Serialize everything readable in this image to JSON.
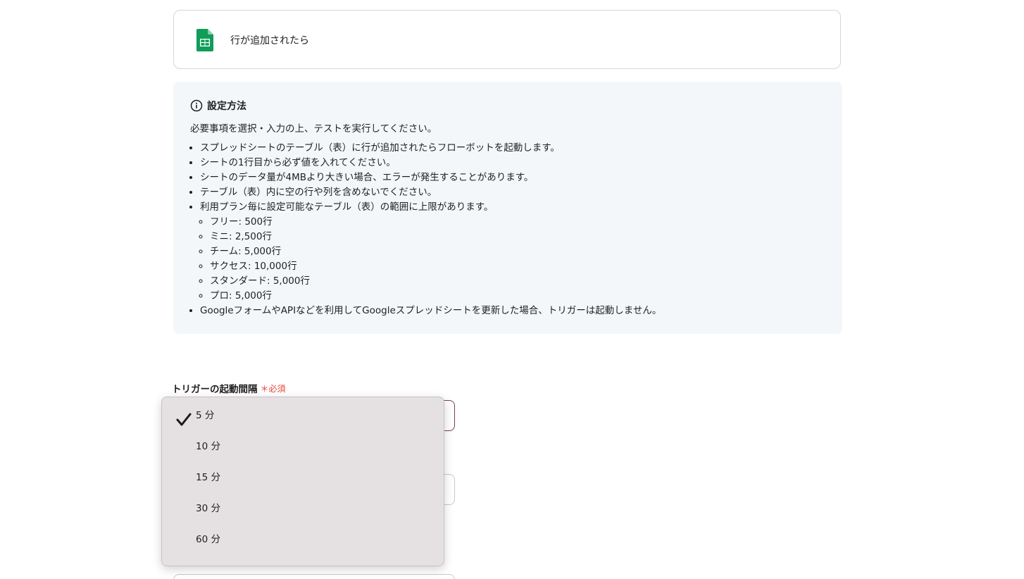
{
  "trigger": {
    "icon": "google-sheets-icon",
    "title": "行が追加されたら"
  },
  "info": {
    "icon": "info-circle-icon",
    "heading": "設定方法",
    "intro": "必要事項を選択・入力の上、テストを実行してください。",
    "items": [
      "スプレッドシートのテーブル（表）に行が追加されたらフローボットを起動します。",
      "シートの1行目から必ず値を入れてください。",
      "シートのデータ量が4MBより大きい場合、エラーが発生することがあります。",
      "テーブル（表）内に空の行や列を含めないでください。",
      "利用プラン毎に設定可能なテーブル（表）の範囲に上限があります。"
    ],
    "plan_limits": [
      "フリー: 500行",
      "ミニ: 2,500行",
      "チーム: 5,000行",
      "サクセス: 10,000行",
      "スタンダード: 5,000行",
      "プロ: 5,000行"
    ],
    "last_item": "GoogleフォームやAPIなどを利用してGoogleスプレッドシートを更新した場合、トリガーは起動しません。"
  },
  "field": {
    "label": "トリガーの起動間隔",
    "required_mark": "＊",
    "required_label": "必須"
  },
  "dropdown": {
    "selected": "5 分",
    "options": [
      "5 分",
      "10 分",
      "15 分",
      "30 分",
      "60 分"
    ]
  },
  "colors": {
    "sheets_green": "#0f9d58",
    "required_red": "#e0453a",
    "info_bg": "#f4f7fa",
    "dropdown_bg": "#e5e0e2"
  }
}
